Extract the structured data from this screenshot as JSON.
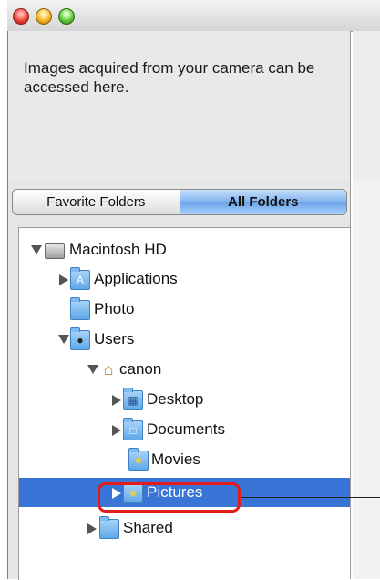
{
  "info": {
    "text": "Images acquired from your camera can be accessed here."
  },
  "tabs": [
    {
      "label": "Favorite Folders",
      "active": false
    },
    {
      "label": "All Folders",
      "active": true
    }
  ],
  "tree": [
    {
      "label": "Macintosh HD",
      "expander": "expanded",
      "icon": "hard-disk-icon"
    },
    {
      "label": "Applications",
      "expander": "collapsed",
      "icon": "applications-folder-icon"
    },
    {
      "label": "Photo",
      "expander": "none",
      "icon": "folder-icon"
    },
    {
      "label": "Users",
      "expander": "expanded",
      "icon": "users-folder-icon"
    },
    {
      "label": "canon",
      "expander": "expanded",
      "icon": "home-icon"
    },
    {
      "label": "Desktop",
      "expander": "collapsed",
      "icon": "desktop-folder-icon"
    },
    {
      "label": "Documents",
      "expander": "collapsed",
      "icon": "documents-folder-icon"
    },
    {
      "label": "Movies",
      "expander": "none",
      "icon": "movies-folder-icon"
    },
    {
      "label": "Pictures",
      "expander": "collapsed",
      "icon": "pictures-folder-icon",
      "selected": true
    },
    {
      "label": "Shared",
      "expander": "collapsed",
      "icon": "folder-icon"
    }
  ],
  "colors": {
    "selection": "#3875d7",
    "highlight_outline": "#e31b1b"
  }
}
